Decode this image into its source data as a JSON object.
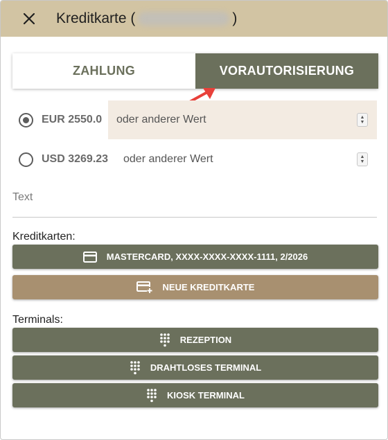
{
  "dialog": {
    "title_prefix": "Kreditkarte (",
    "title_suffix": ")"
  },
  "tabs": [
    {
      "label": "ZAHLUNG",
      "active": false
    },
    {
      "label": "VORAUTORISIERUNG",
      "active": true
    }
  ],
  "amounts": [
    {
      "value": "EUR 2550.0",
      "selected": true,
      "other_placeholder": "oder anderer Wert"
    },
    {
      "value": "USD 3269.23",
      "selected": false,
      "other_placeholder": "oder anderer Wert"
    }
  ],
  "text_field": {
    "placeholder": "Text"
  },
  "credit_cards": {
    "label": "Kreditkarten:",
    "card_button": "MASTERCARD, XXXX-XXXX-XXXX-1111, 2/2026",
    "new_card_button": "NEUE KREDITKARTE"
  },
  "terminals": {
    "label": "Terminals:",
    "items": [
      "REZEPTION",
      "DRAHTLOSES TERMINAL",
      "KIOSK TERMINAL"
    ]
  },
  "colors": {
    "header": "#d2c4a3",
    "primary_green": "#6b705c",
    "tan_button": "#a89070",
    "selected_row": "#f3ebe2",
    "arrow": "#e8403a"
  },
  "icons": {
    "close": "close-icon",
    "card": "credit-card-icon",
    "new_card": "add-card-icon",
    "terminal": "dialpad-icon"
  }
}
